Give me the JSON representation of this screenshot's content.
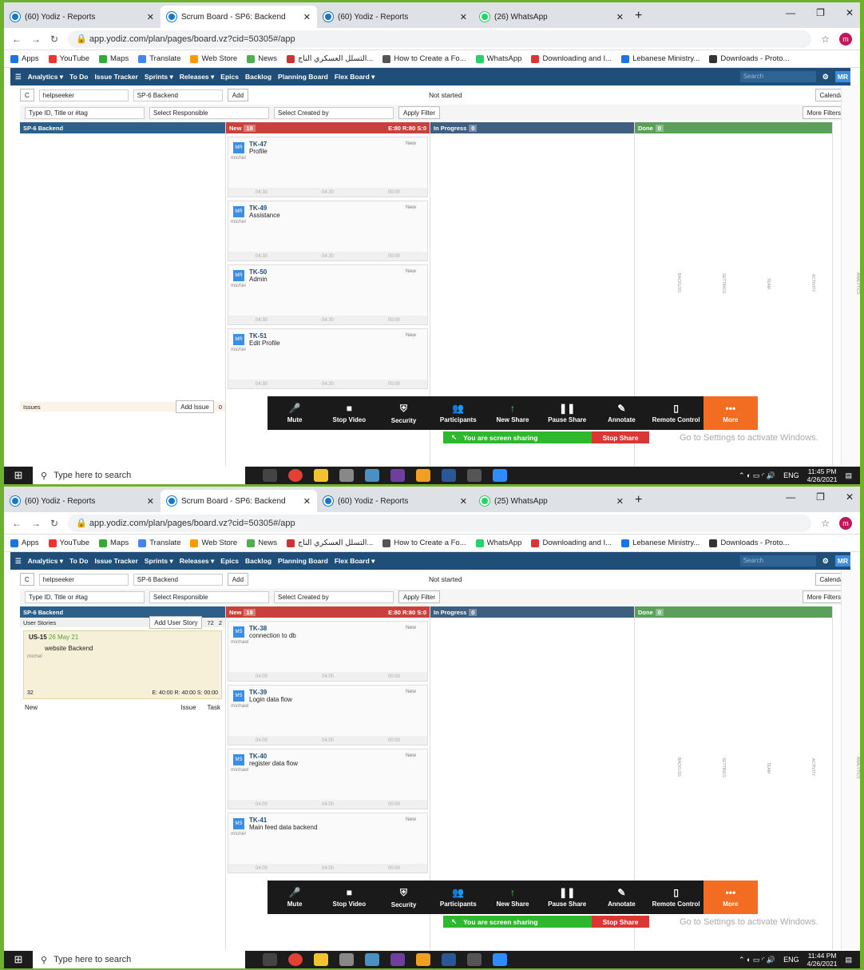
{
  "shots": [
    {
      "tabs": [
        "(60) Yodiz - Reports",
        "Scrum Board - SP6: Backend",
        "(60) Yodiz - Reports",
        "(26) WhatsApp"
      ],
      "time": "11:45 PM",
      "date": "4/26/2021",
      "cards": [
        {
          "id": "TK-47",
          "title": "Profile",
          "user": "michel"
        },
        {
          "id": "TK-49",
          "title": "Assistance",
          "user": "michel"
        },
        {
          "id": "TK-50",
          "title": "Admin",
          "user": "michel"
        },
        {
          "id": "TK-51",
          "title": "Edit Profile",
          "user": "michel"
        }
      ]
    },
    {
      "tabs": [
        "(60) Yodiz - Reports",
        "Scrum Board - SP6: Backend",
        "(60) Yodiz - Reports",
        "(25) WhatsApp"
      ],
      "time": "11:44 PM",
      "date": "4/26/2021",
      "cards": [
        {
          "id": "TK-38",
          "title": "connection to db",
          "user": "michael"
        },
        {
          "id": "TK-39",
          "title": "Login data flow",
          "user": "michael"
        },
        {
          "id": "TK-40",
          "title": "register data flow",
          "user": "michael"
        },
        {
          "id": "TK-41",
          "title": "Main feed data backend",
          "user": "michel"
        }
      ]
    }
  ],
  "url": "app.yodiz.com/plan/pages/board.vz?cid=50305#/app",
  "bookmarks": [
    "Apps",
    "YouTube",
    "Maps",
    "Translate",
    "Web Store",
    "News",
    "التسلل العسكري الناج...",
    "How to Create a Fo...",
    "WhatsApp",
    "Downloading and I...",
    "Lebanese Ministry...",
    "Downloads - Proto..."
  ],
  "nav": [
    "Analytics ▾",
    "To Do",
    "Issue Tracker",
    "Sprints ▾",
    "Releases ▾",
    "Epics",
    "Backlog",
    "Planning Board",
    "Flex Board ▾"
  ],
  "search_placeholder": "Search",
  "ctrl": {
    "project": "helpseeker",
    "sprint": "SP-6 Backend",
    "add": "Add",
    "status": "Not started",
    "calendar": "Calendar"
  },
  "filters": {
    "id": "Type ID, Title or #tag",
    "resp": "Select Responsible",
    "created": "Select Created by",
    "apply": "Apply Filter",
    "more": "More Filters"
  },
  "cols": {
    "sp": "SP-6 Backend",
    "new": "New",
    "new_count": "18",
    "new_est": "E:80 R:80 S:0",
    "prog": "In Progress",
    "prog_count": "0",
    "done": "Done",
    "done_count": "0"
  },
  "card_state": "New",
  "times": [
    "04:30",
    "04:30",
    "00:00"
  ],
  "times2": [
    "04:00",
    "04:00",
    "00:00"
  ],
  "issues": "Issues",
  "add_issue": "Add Issue",
  "issue_count": "0",
  "us": {
    "label": "User Stories",
    "add": "Add User Story",
    "n1": "72",
    "n2": "2",
    "id": "US-15",
    "date": "26 May 21",
    "title": "website Backend",
    "user": "michel",
    "size": "32",
    "est": "E: 40:00 R: 40:00 S: 00:00",
    "state": "New",
    "issue": "Issue",
    "task": "Task"
  },
  "zoom": [
    "Mute",
    "Stop Video",
    "Security",
    "Participants",
    "New Share",
    "Pause Share",
    "Annotate",
    "Remote Control",
    "More"
  ],
  "sharing": "You are screen sharing",
  "stop_share": "Stop Share",
  "watermark": "Go to Settings to activate Windows.",
  "taskbar_search": "Type here to search",
  "lang": "ENG",
  "rail": [
    "ANALYTICS",
    "ACTIVITY",
    "TEAM",
    "SETTINGS",
    "BACKLOG"
  ]
}
